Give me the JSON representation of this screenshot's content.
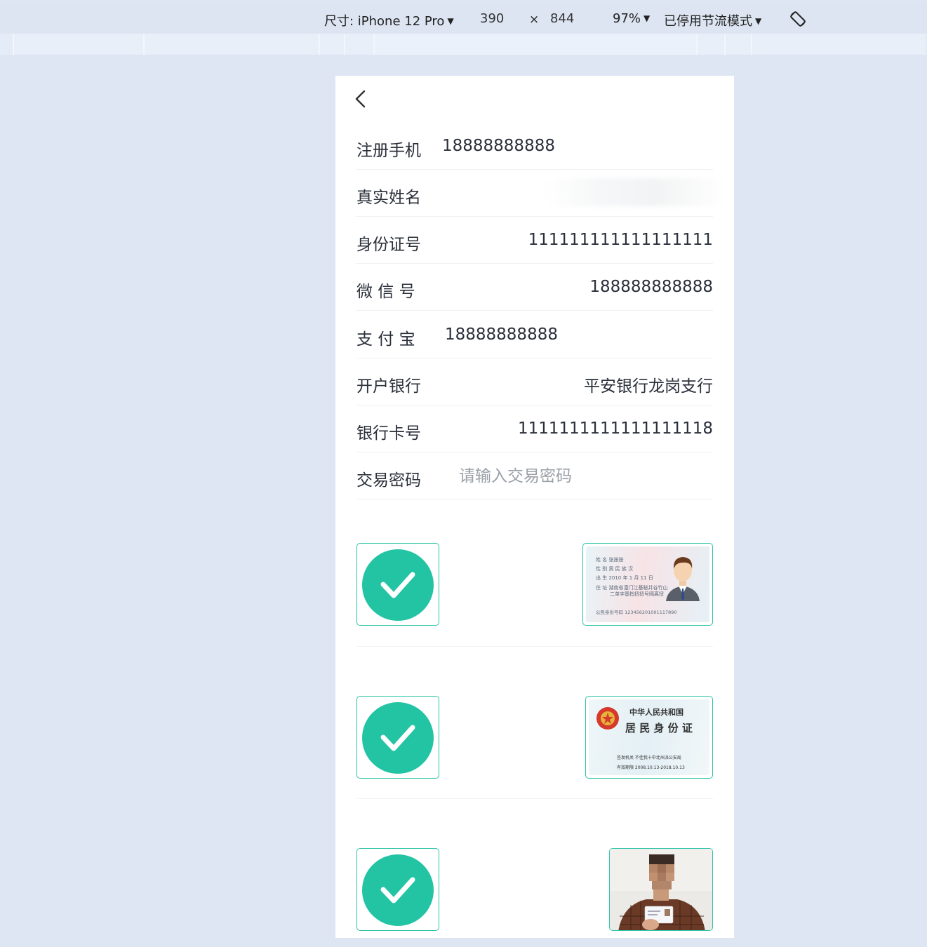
{
  "devtools": {
    "device_label": "尺寸: iPhone 12 Pro",
    "width": "390",
    "times": "×",
    "height": "844",
    "zoom": "97%",
    "throttle": "已停用节流模式",
    "rotate_icon": "rotate-icon"
  },
  "form": {
    "back_icon": "chevron-left-icon",
    "rows": [
      {
        "label": "注册手机",
        "value": "18888888888"
      },
      {
        "label": "真实姓名",
        "value": ""
      },
      {
        "label": "身份证号",
        "value": "111111111111111111"
      },
      {
        "label": "微 信 号",
        "value": "188888888888"
      },
      {
        "label": "支 付 宝",
        "value": "18888888888"
      },
      {
        "label": "开户银行",
        "value": "平安银行龙岗支行"
      },
      {
        "label": "银行卡号",
        "value": "1111111111111111118"
      },
      {
        "label": "交易密码",
        "placeholder": "请输入交易密码"
      }
    ]
  },
  "uploads": {
    "check_icon": "checkmark-icon",
    "id_front": {
      "name_line": "姓 名  张按按",
      "sex_line": "性 别  男     民 族  汉",
      "birth_line": "出 生  2010    年  1    月  11  日",
      "addr_line1": "住 址  湖南省澧门江基秘井谷竹山",
      "addr_line2": "二单字基指扭扭号隔离扭",
      "id_line": "公民身份号码    123456201001117890"
    },
    "id_back": {
      "country": "中华人民共和国",
      "title": "居 民 身 份 证",
      "authority": "签发机关  不佳我十中北州派公安局",
      "validity": "有效期限  2008.10.13-2018.10.13"
    },
    "holding_photo": "person-holding-id-photo"
  }
}
